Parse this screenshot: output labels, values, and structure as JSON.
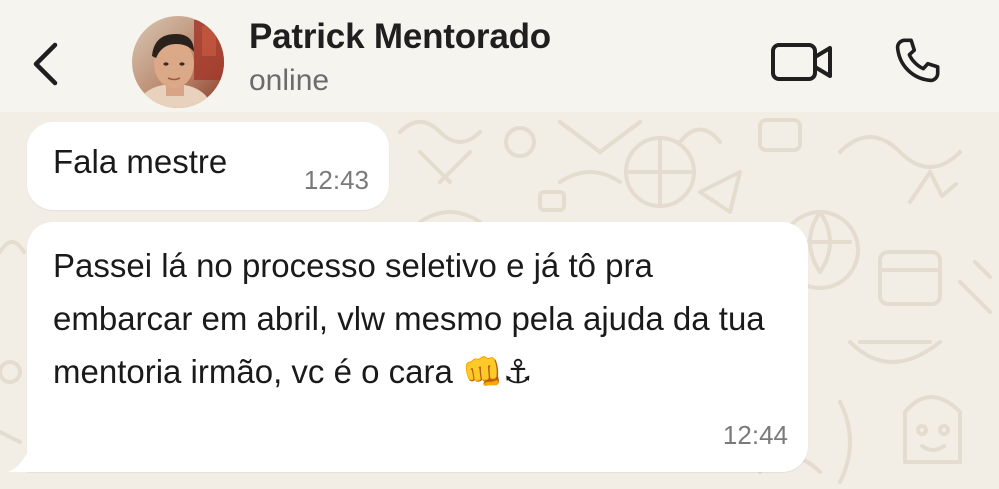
{
  "header": {
    "contact_name": "Patrick Mentorado",
    "status": "online",
    "back_icon": "chevron-left-icon",
    "video_icon": "video-camera-icon",
    "call_icon": "phone-icon"
  },
  "messages": [
    {
      "text": "Fala mestre",
      "time": "12:43"
    },
    {
      "text": "Passei lá no processo seletivo e já tô pra embarcar em abril, vlw mesmo pela ajuda da tua mentoria irmão, vc é o cara 👊⚓",
      "time": "12:44"
    }
  ],
  "colors": {
    "bubble": "#ffffff",
    "chat_background": "#f2ede5",
    "header_background": "#f6f4ef",
    "doodle": "#e4dccf"
  }
}
